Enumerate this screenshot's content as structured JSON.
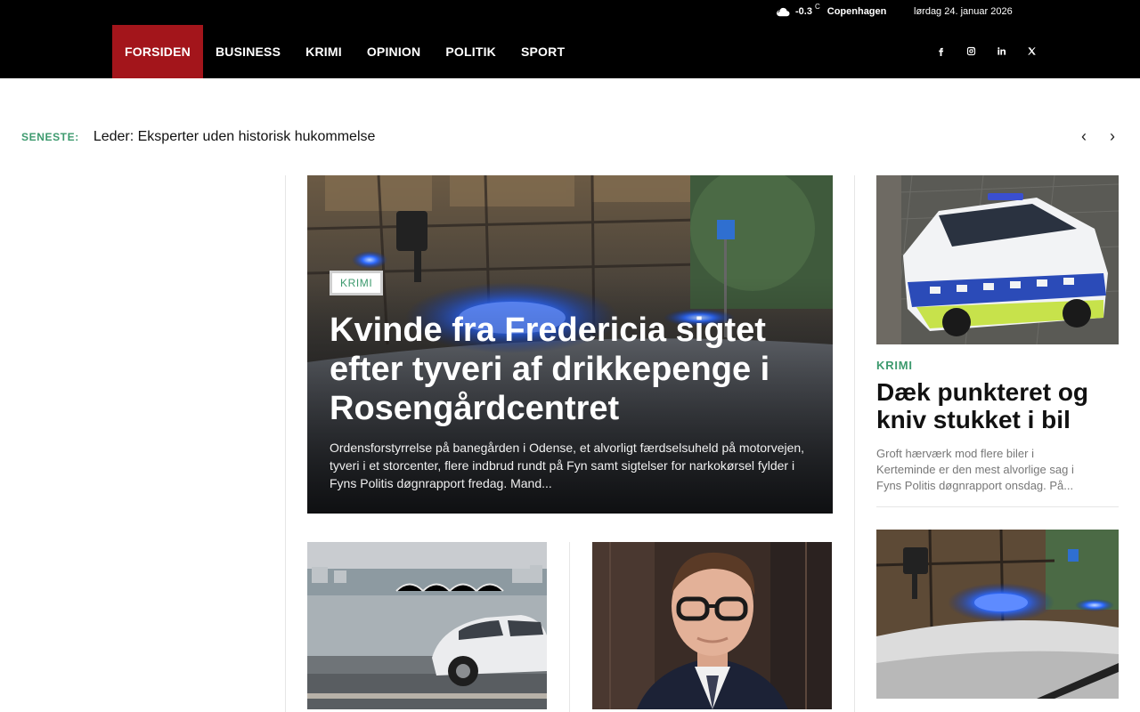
{
  "topbar": {
    "temperature": "-0.3",
    "unit": "C",
    "city": "Copenhagen",
    "date": "lørdag 24. januar 2026",
    "weather_icon": "cloud-icon"
  },
  "nav": {
    "items": [
      {
        "label": "FORSIDEN",
        "active": true
      },
      {
        "label": "BUSINESS"
      },
      {
        "label": "KRIMI"
      },
      {
        "label": "OPINION"
      },
      {
        "label": "POLITIK"
      },
      {
        "label": "SPORT"
      }
    ],
    "active_color": "#a3151b"
  },
  "social": [
    "facebook-icon",
    "instagram-icon",
    "linkedin-icon",
    "x-icon"
  ],
  "ticker": {
    "label": "SENESTE:",
    "title": "Leder: Eksperter uden historisk hukommelse"
  },
  "feature": {
    "category": "KRIMI",
    "title": "Kvinde fra Fredericia sigtet efter tyveri af drikkepenge i Rosengårdcentret",
    "excerpt": "Ordensforstyrrelse på banegården i Odense, et alvorligt færdselsuheld på motorvejen, tyveri i et storcenter, flere indbrud rundt på Fyn samt sigtelser for narkokørsel fylder i Fyns Politis døgnrapport fredag. Mand..."
  },
  "side_cards": [
    {
      "category": "KRIMI",
      "title": "Dæk punkteret og kniv stukket i bil",
      "excerpt": "Groft hærværk mod flere biler i Kerteminde er den mest alvorlige sag i Fyns Politis døgnrapport onsdag. På..."
    }
  ],
  "accent_color": "#3d9a6e"
}
